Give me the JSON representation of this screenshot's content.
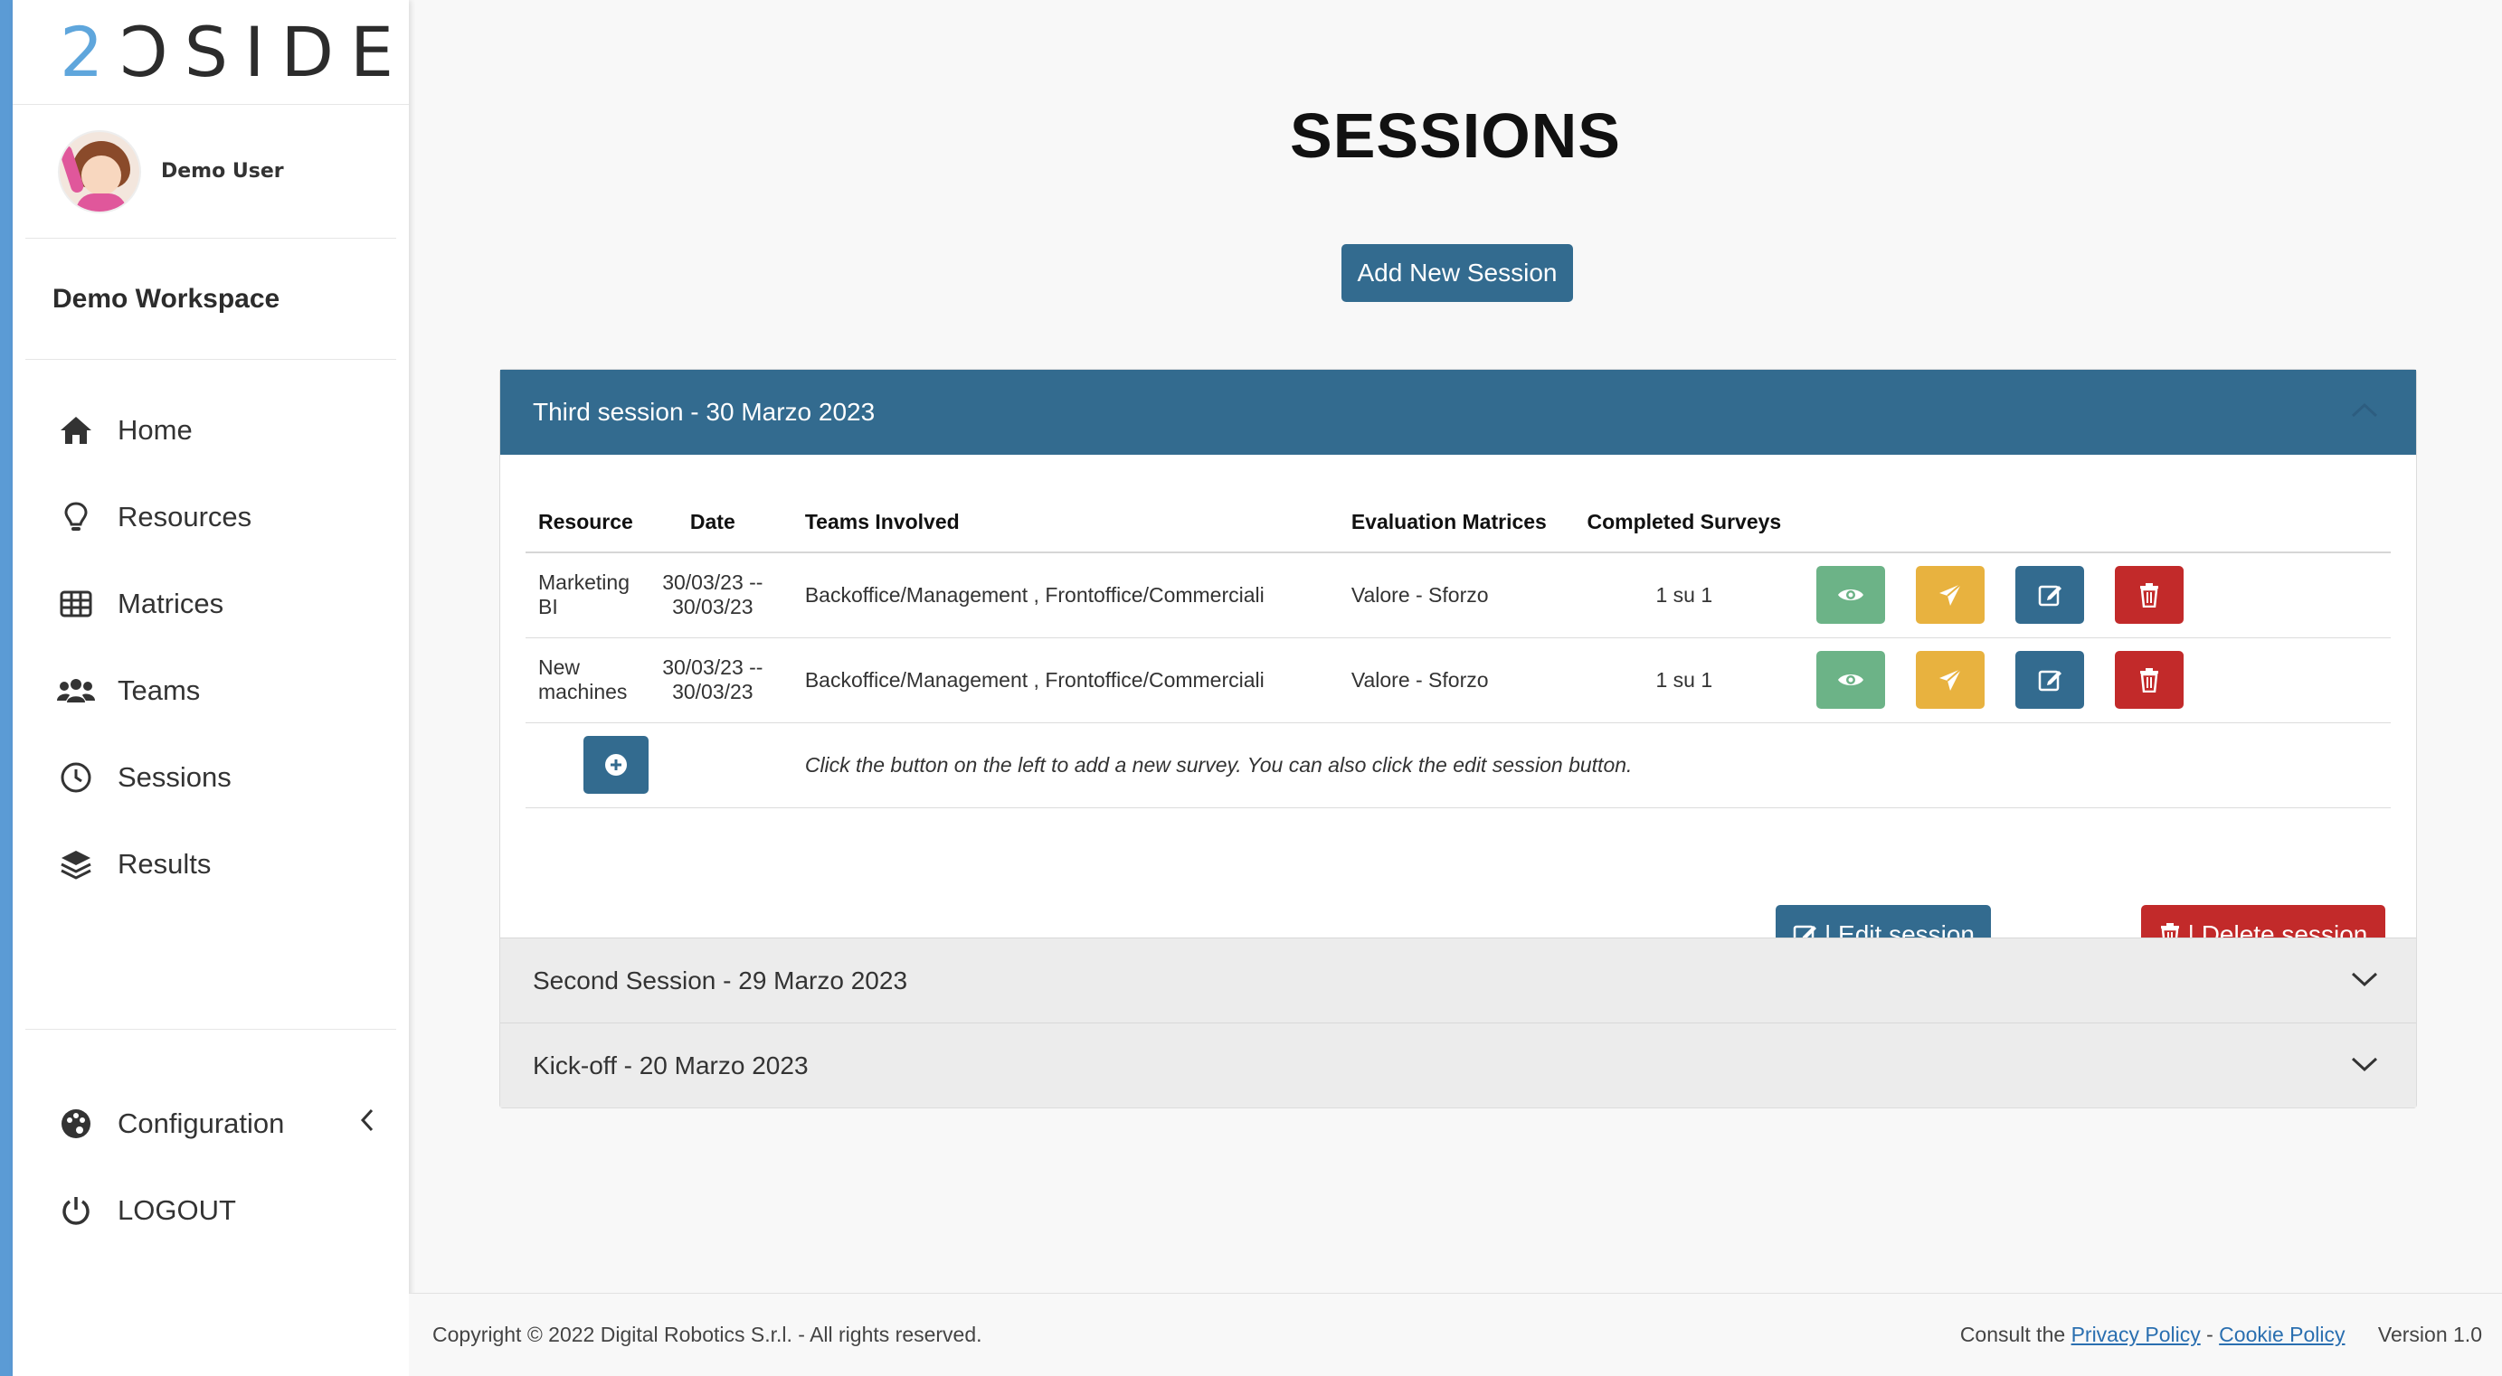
{
  "brand": {
    "logo_text_accent": "2",
    "logo_text_rest": "ƆSIDE"
  },
  "user": {
    "name": "Demo User"
  },
  "workspace": {
    "name": "Demo Workspace"
  },
  "sidebar": {
    "items": [
      {
        "label": "Home",
        "icon": "home-icon"
      },
      {
        "label": "Resources",
        "icon": "lightbulb-icon"
      },
      {
        "label": "Matrices",
        "icon": "table-grid-icon"
      },
      {
        "label": "Teams",
        "icon": "users-icon"
      },
      {
        "label": "Sessions",
        "icon": "clock-icon"
      },
      {
        "label": "Results",
        "icon": "layers-icon"
      }
    ],
    "bottom": [
      {
        "label": "Configuration",
        "icon": "palette-icon"
      },
      {
        "label": "LOGOUT",
        "icon": "power-icon"
      }
    ]
  },
  "main": {
    "title": "SESSIONS",
    "add_button": "Add New Session",
    "sessions": [
      {
        "title": "Third session - 30 Marzo 2023",
        "expanded": true,
        "columns": [
          "Resource",
          "Date",
          "Teams Involved",
          "Evaluation Matrices",
          "Completed Surveys"
        ],
        "rows": [
          {
            "resource": "Marketing BI",
            "date": "30/03/23 -- 30/03/23",
            "teams": "Backoffice/Management , Frontoffice/Commerciali",
            "matrices": "Valore - Sforzo",
            "completed": "1 su 1"
          },
          {
            "resource": "New machines",
            "date": "30/03/23 -- 30/03/23",
            "teams": "Backoffice/Management , Frontoffice/Commerciali",
            "matrices": "Valore - Sforzo",
            "completed": "1 su 1"
          }
        ],
        "hint": "Click the button on the left to add a new survey. You can also click the edit session button.",
        "edit_label": "| Edit session",
        "delete_label": "| Delete session"
      },
      {
        "title": "Second Session - 29 Marzo 2023",
        "expanded": false
      },
      {
        "title": "Kick-off - 20 Marzo 2023",
        "expanded": false
      }
    ]
  },
  "footer": {
    "copyright": "Copyright © 2022 Digital Robotics S.r.l. - All rights reserved.",
    "consult": "Consult the",
    "privacy": "Privacy Policy",
    "separator": "-",
    "cookie": "Cookie Policy",
    "version": "Version 1.0"
  },
  "colors": {
    "primary": "#336b8f",
    "view": "#6cb387",
    "send": "#e8b23f",
    "danger": "#c22a2a",
    "accent_strip": "#5b9bd5"
  }
}
